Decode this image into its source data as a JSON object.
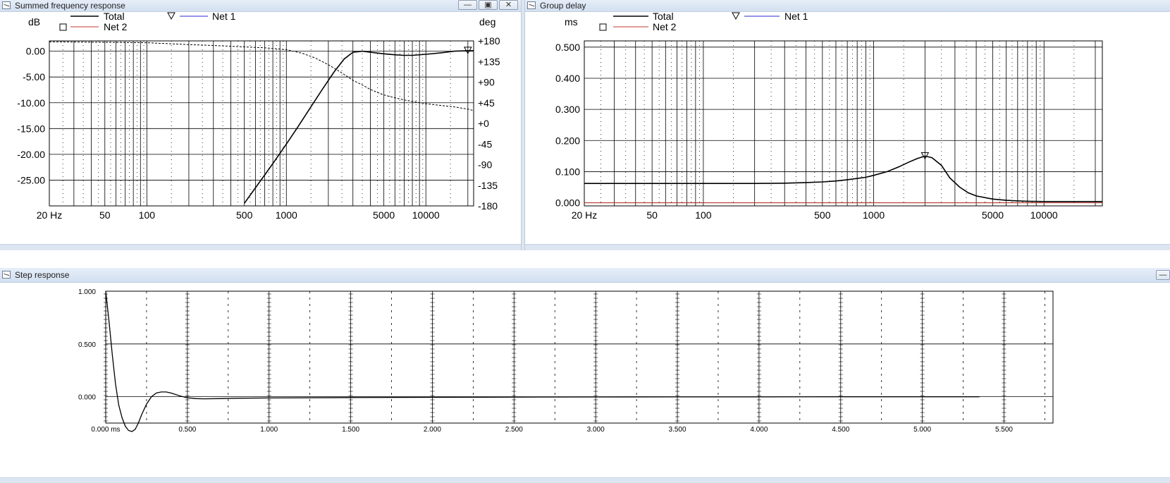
{
  "windows": {
    "freq": {
      "title": "Summed frequency response",
      "buttons": [
        "▭",
        "◫",
        "✕"
      ]
    },
    "gd": {
      "title": "Group delay"
    },
    "step": {
      "title": "Step response"
    }
  },
  "legend": {
    "total": "Total",
    "net1": "Net 1",
    "net2": "Net 2"
  },
  "colors": {
    "total": "#000000",
    "net1": "#2b2bd0",
    "net2": "#c0392b",
    "grid": "#000000",
    "titlebar": "#d3e0f0"
  },
  "chart_data": [
    {
      "type": "line",
      "title": "Summed frequency response",
      "xlabel": "",
      "ylabel": "dB",
      "y2label": "deg",
      "x_scale": "log",
      "xlim": [
        20,
        22000
      ],
      "ylim": [
        -30,
        2
      ],
      "y2lim": [
        -180,
        180
      ],
      "x_tick_labels": [
        "20 Hz",
        "50",
        "100",
        "500",
        "1000",
        "5000",
        "10000"
      ],
      "x_tick_values": [
        20,
        50,
        100,
        500,
        1000,
        5000,
        10000
      ],
      "y_tick_labels": [
        "0.00",
        "-5.00",
        "-10.00",
        "-15.00",
        "-20.00",
        "-25.00"
      ],
      "y_tick_values": [
        0,
        -5,
        -10,
        -15,
        -20,
        -25
      ],
      "y2_tick_labels": [
        "+180",
        "+135",
        "+90",
        "+45",
        "+0",
        "-45",
        "-90",
        "-135",
        "-180"
      ],
      "y2_tick_values": [
        180,
        135,
        90,
        45,
        0,
        -45,
        -90,
        -135,
        -180
      ],
      "series": [
        {
          "name": "Total",
          "values_x": [
            500,
            600,
            700,
            800,
            900,
            1000,
            1200,
            1500,
            1800,
            2200,
            2600,
            3000,
            3500,
            4000,
            5000,
            6000,
            7000,
            8000,
            10000,
            13000,
            16000,
            20000,
            22000
          ],
          "values_y": [
            -29.5,
            -26.5,
            -24.0,
            -21.8,
            -19.8,
            -18.0,
            -14.8,
            -10.8,
            -7.5,
            -4.0,
            -1.5,
            -0.2,
            0.0,
            -0.2,
            -0.5,
            -0.7,
            -0.8,
            -0.8,
            -0.6,
            -0.3,
            0.0,
            0.1,
            0.1
          ]
        },
        {
          "name": "Phase",
          "axis": "deg",
          "line": "dashed",
          "values_x": [
            20,
            50,
            100,
            200,
            300,
            500,
            700,
            1000,
            1300,
            1600,
            2000,
            2500,
            3000,
            3500,
            4000,
            5000,
            6000,
            7000,
            8000,
            10000,
            13000,
            16000,
            20000,
            22000
          ],
          "values_y": [
            178,
            177,
            176,
            172,
            170,
            167,
            165,
            161,
            153,
            143,
            128,
            110,
            94,
            84,
            74,
            62,
            56,
            51,
            48,
            43,
            39,
            36,
            31,
            28
          ]
        }
      ],
      "markers": [
        {
          "series": "Net 1",
          "shape": "triangle",
          "x": 20000,
          "y": 0.1
        }
      ],
      "grid": true
    },
    {
      "type": "line",
      "title": "Group delay",
      "ylabel": "ms",
      "x_scale": "log",
      "xlim": [
        20,
        22000
      ],
      "ylim": [
        -0.01,
        0.52
      ],
      "x_tick_labels": [
        "20 Hz",
        "50",
        "100",
        "500",
        "1000",
        "5000",
        "10000"
      ],
      "x_tick_values": [
        20,
        50,
        100,
        500,
        1000,
        5000,
        10000
      ],
      "y_tick_labels": [
        "0.500",
        "0.400",
        "0.300",
        "0.200",
        "0.100",
        "0.000"
      ],
      "y_tick_values": [
        0.5,
        0.4,
        0.3,
        0.2,
        0.1,
        0
      ],
      "series": [
        {
          "name": "Total",
          "values_x": [
            20,
            50,
            100,
            200,
            300,
            400,
            500,
            600,
            700,
            800,
            900,
            1000,
            1200,
            1400,
            1600,
            1800,
            2000,
            2200,
            2500,
            2800,
            3200,
            3600,
            4000,
            5000,
            6000,
            7000,
            8000,
            10000,
            15000,
            22000
          ],
          "values_y": [
            0.062,
            0.062,
            0.062,
            0.062,
            0.063,
            0.065,
            0.067,
            0.07,
            0.074,
            0.078,
            0.082,
            0.088,
            0.1,
            0.115,
            0.13,
            0.142,
            0.15,
            0.145,
            0.12,
            0.08,
            0.05,
            0.032,
            0.022,
            0.012,
            0.008,
            0.006,
            0.005,
            0.004,
            0.004,
            0.004
          ]
        },
        {
          "name": "Net 2",
          "values_x": [
            20,
            22000
          ],
          "values_y": [
            0,
            0
          ]
        }
      ],
      "markers": [
        {
          "series": "Net 1",
          "shape": "triangle",
          "x": 2000,
          "y": 0.15
        }
      ],
      "grid": true
    },
    {
      "type": "line",
      "title": "Step response",
      "xlim": [
        0,
        5.8
      ],
      "ylim": [
        -0.25,
        1.0
      ],
      "x_tick_labels": [
        "0.000 ms",
        "0.500",
        "1.000",
        "1.500",
        "2.000",
        "2.500",
        "3.000",
        "3.500",
        "4.000",
        "4.500",
        "5.000",
        "5.500"
      ],
      "x_tick_values": [
        0,
        0.5,
        1.0,
        1.5,
        2.0,
        2.5,
        3.0,
        3.5,
        4.0,
        4.5,
        5.0,
        5.5
      ],
      "y_tick_labels": [
        "1.000",
        "0.500",
        "0.000"
      ],
      "y_tick_values": [
        1.0,
        0.5,
        0.0
      ],
      "series": [
        {
          "name": "Total",
          "values_x": [
            0.0,
            0.02,
            0.04,
            0.06,
            0.08,
            0.1,
            0.12,
            0.14,
            0.16,
            0.18,
            0.2,
            0.22,
            0.25,
            0.28,
            0.31,
            0.34,
            0.37,
            0.4,
            0.43,
            0.46,
            0.5,
            0.55,
            0.6,
            0.7,
            0.8,
            1.0,
            1.5,
            2.0,
            2.5,
            3.0,
            3.5,
            4.0,
            4.5,
            5.0,
            5.35
          ],
          "values_y": [
            1.0,
            0.72,
            0.4,
            0.12,
            -0.08,
            -0.2,
            -0.28,
            -0.32,
            -0.33,
            -0.31,
            -0.25,
            -0.17,
            -0.07,
            0.0,
            0.035,
            0.045,
            0.045,
            0.035,
            0.02,
            0.005,
            -0.01,
            -0.018,
            -0.02,
            -0.018,
            -0.015,
            -0.012,
            -0.008,
            -0.006,
            -0.004,
            -0.003,
            -0.002,
            -0.002,
            -0.001,
            -0.001,
            -0.001
          ]
        }
      ],
      "grid": true
    }
  ]
}
